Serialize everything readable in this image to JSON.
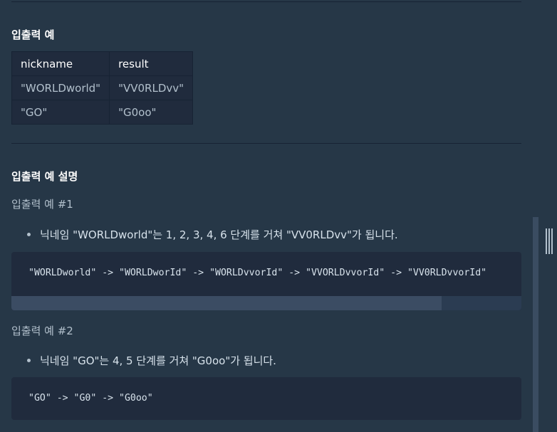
{
  "section_title": "입출력 예",
  "table": {
    "headers": [
      "nickname",
      "result"
    ],
    "rows": [
      [
        "\"WORLDworld\"",
        "\"VV0RLDvv\""
      ],
      [
        "\"GO\"",
        "\"G0oo\""
      ]
    ]
  },
  "explain_title": "입출력 예 설명",
  "examples": [
    {
      "label": "입출력 예 #1",
      "bullet": "닉네임 \"WORLDworld\"는 1, 2, 3, 4, 6 단계를 거쳐 \"VV0RLDvv\"가 됩니다.",
      "code": "\"WORLDworld\" -> \"WORLDworId\" -> \"WORLDvvorId\" -> \"VVORLDvvorId\" -> \"VV0RLDvvorId\""
    },
    {
      "label": "입출력 예 #2",
      "bullet": "닉네임 \"GO\"는 4, 5 단계를 거쳐 \"G0oo\"가 됩니다.",
      "code": "\"GO\" -> \"G0\" -> \"G0oo\""
    }
  ],
  "colors": {
    "background": "#263747",
    "code_background": "#202b3d",
    "text": "#d7e2eb",
    "muted": "#b2c0cc"
  },
  "icons": [
    "resize-handle-icon"
  ]
}
